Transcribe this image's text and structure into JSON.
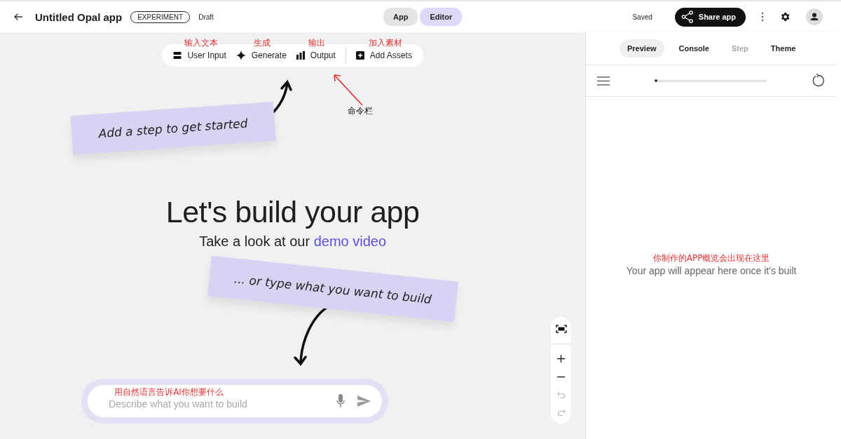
{
  "header": {
    "title": "Untitled Opal app",
    "badge": "EXPERIMENT",
    "status": "Draft",
    "save_state": "Saved",
    "share_button": "Share app",
    "mode_tabs": [
      {
        "label": "App",
        "selected": false
      },
      {
        "label": "Editor",
        "selected": true
      }
    ]
  },
  "toolbar": {
    "annotation": "命令栏",
    "items": [
      {
        "label": "User Input",
        "kind": "input",
        "annotation": "输入文本"
      },
      {
        "label": "Generate",
        "kind": "generate",
        "annotation": "生成"
      },
      {
        "label": "Output",
        "kind": "output",
        "annotation": "输出"
      },
      {
        "label": "Add Assets",
        "kind": "assets",
        "annotation": "加入素材"
      }
    ]
  },
  "notes": [
    "Add a step to get started",
    "... or type what you want to build"
  ],
  "hero": {
    "title": "Let's build your app",
    "subtitle": "Take a look at our",
    "link": "demo video"
  },
  "prompt": {
    "placeholder": "Describe what you want to build",
    "annotation": "用自然语言告诉AI你想要什么"
  },
  "panel": {
    "tabs": [
      {
        "label": "Preview",
        "selected": true,
        "disabled": false
      },
      {
        "label": "Console",
        "selected": false,
        "disabled": false
      },
      {
        "label": "Step",
        "selected": false,
        "disabled": true
      },
      {
        "label": "Theme",
        "selected": false,
        "disabled": false
      }
    ],
    "empty_message": "Your app will appear here once it's built",
    "annotation": "你制作的APP概览会出现在这里"
  }
}
